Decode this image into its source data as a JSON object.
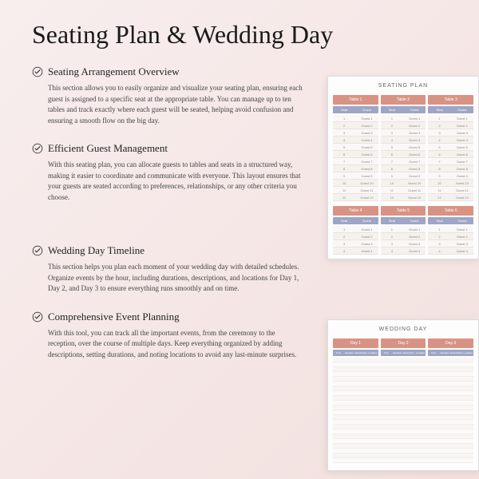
{
  "title": "Seating Plan & Wedding Day",
  "sections": [
    {
      "heading": "Seating Arrangement Overview",
      "body": "This section allows you to easily organize and visualize your seating plan, ensuring each guest is assigned to a specific seat at the appropriate table. You can manage up to ten tables and track exactly where each guest will be seated, helping avoid confusion and ensuring a smooth flow on the big day."
    },
    {
      "heading": "Efficient Guest Management",
      "body": "With this seating plan, you can allocate guests to tables and seats in a structured way, making it easier to coordinate and communicate with everyone. This layout ensures that your guests are seated according to preferences, relationships, or any other criteria you choose."
    },
    {
      "heading": "Wedding Day Timeline",
      "body": "This section helps you plan each moment of your wedding day with detailed schedules. Organize events by the hour, including durations, descriptions, and locations for Day 1, Day 2, and Day 3 to ensure everything runs smoothly and on time."
    },
    {
      "heading": "Comprehensive Event Planning",
      "body": "With this tool, you can track all the important events, from the ceremony to the reception, over the course of multiple days. Keep everything organized by adding descriptions, setting durations, and noting locations to avoid any last-minute surprises."
    }
  ],
  "preview1": {
    "title": "SEATING PLAN",
    "tableHeaders": [
      "Table 1",
      "Table 2",
      "Table 3"
    ],
    "tableHeaders2": [
      "Table 4",
      "Table 5",
      "Table 6"
    ],
    "subHeaders": [
      "Seat",
      "Guest"
    ],
    "guestLabel": "Guest"
  },
  "preview2": {
    "title": "WEDDING DAY",
    "dayHeaders": [
      "Day 1",
      "Day 2",
      "Day 3"
    ],
    "daySub": [
      "Time",
      "Duration",
      "Description",
      "Location"
    ]
  }
}
